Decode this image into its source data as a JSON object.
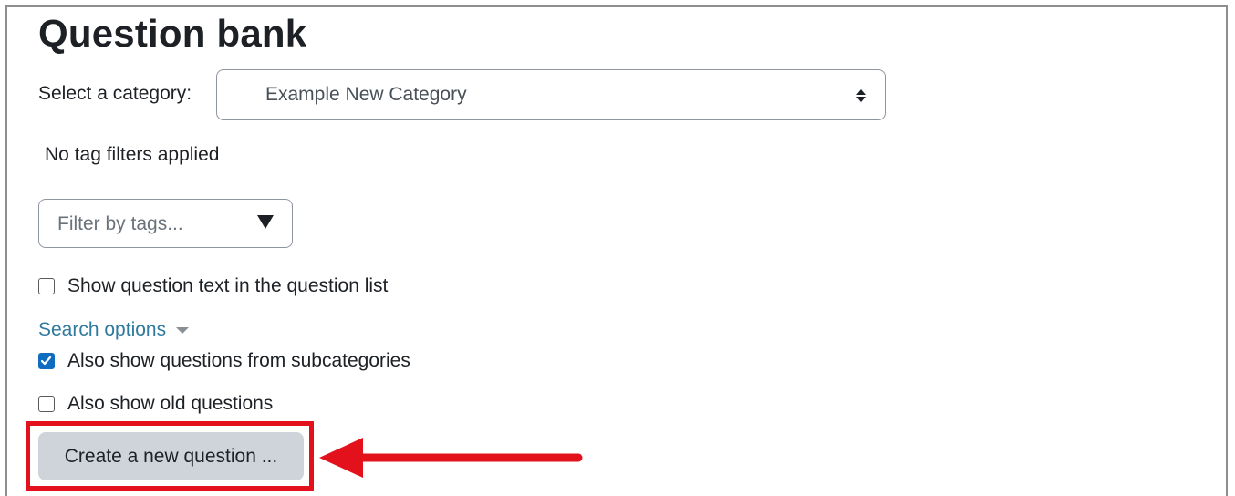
{
  "page": {
    "title": "Question bank"
  },
  "category": {
    "label": "Select a category:",
    "selected": "Example New Category"
  },
  "tags": {
    "status": "No tag filters applied",
    "filter_placeholder": "Filter by tags..."
  },
  "options": {
    "show_question_text": {
      "label": "Show question text in the question list",
      "checked": false
    },
    "search_options_label": "Search options",
    "subcategories": {
      "label": "Also show questions from subcategories",
      "checked": true
    },
    "old_questions": {
      "label": "Also show old questions",
      "checked": false
    }
  },
  "actions": {
    "create_label": "Create a new question ..."
  },
  "colors": {
    "link": "#2f7a9e",
    "checkbox_checked": "#0f6cbf",
    "annotation": "#e3111b",
    "button_bg": "#ced4da"
  },
  "icons": {
    "select_indicator": "up-down-arrows-icon",
    "tag_dropdown": "triangle-down-icon",
    "search_caret": "caret-down-icon",
    "annotation_arrow": "arrow-left-icon"
  }
}
